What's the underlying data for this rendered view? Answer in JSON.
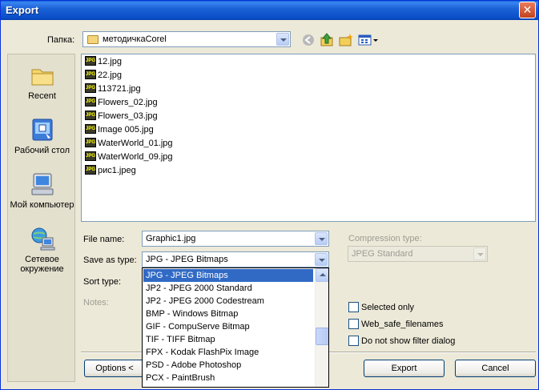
{
  "window": {
    "title": "Export",
    "close_glyph": "✕"
  },
  "folder_bar": {
    "label": "Папка:",
    "current_folder": "методичкаCorel"
  },
  "places": [
    {
      "label": "Recent",
      "icon": "recent-folder-icon"
    },
    {
      "label": "Рабочий стол",
      "icon": "desktop-icon"
    },
    {
      "label": "Мой компьютер",
      "icon": "my-computer-icon"
    },
    {
      "label": "Сетевое окружение",
      "icon": "network-icon"
    }
  ],
  "files": [
    "12.jpg",
    "22.jpg",
    "113721.jpg",
    "Flowers_02.jpg",
    "Flowers_03.jpg",
    "Image 005.jpg",
    "WaterWorld_01.jpg",
    "WaterWorld_09.jpg",
    "рис1.jpeg"
  ],
  "file_icon_text": "JPG",
  "form": {
    "file_name_label": "File name:",
    "file_name_value": "Graphic1.jpg",
    "save_as_type_label": "Save as type:",
    "save_as_type_value": "JPG - JPEG Bitmaps",
    "sort_type_label": "Sort type:",
    "notes_label": "Notes:",
    "compression_label": "Compression type:",
    "compression_value": "JPEG Standard"
  },
  "type_options": [
    "JPG - JPEG Bitmaps",
    "JP2 - JPEG 2000 Standard",
    "JP2 - JPEG 2000 Codestream",
    "BMP - Windows Bitmap",
    "GIF - CompuServe Bitmap",
    "TIF - TIFF Bitmap",
    "FPX - Kodak FlashPix Image",
    "PSD - Adobe Photoshop",
    "PCX - PaintBrush"
  ],
  "checkboxes": {
    "selected_only": "Selected only",
    "web_safe": "Web_safe_filenames",
    "no_filter_dialog": "Do not show filter dialog"
  },
  "buttons": {
    "options": "Options <",
    "export": "Export",
    "cancel": "Cancel"
  }
}
